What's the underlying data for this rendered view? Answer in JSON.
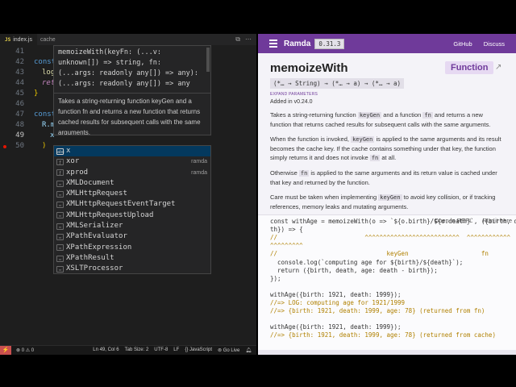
{
  "editor": {
    "tabs": [
      {
        "icon": "JS",
        "label": "index.js"
      },
      {
        "label": "cache"
      }
    ],
    "lines": [
      {
        "num": "41",
        "y": 0
      },
      {
        "num": "42",
        "y": 1
      },
      {
        "num": "43",
        "y": 2
      },
      {
        "num": "44",
        "y": 3
      },
      {
        "num": "45",
        "y": 4
      },
      {
        "num": "46",
        "y": 5
      },
      {
        "num": "47",
        "y": 6
      },
      {
        "num": "48",
        "y": 7
      },
      {
        "num": "49",
        "y": 8
      },
      {
        "num": "50",
        "y": 9
      }
    ],
    "code": {
      "l42": "const",
      "l43": "log",
      "l44": "ret",
      "l45": "}",
      "l47": "const",
      "l48": "R.m",
      "l49": "x",
      "l50": ")"
    },
    "hover": {
      "sig1": "memoizeWith(keyFn: (...v:",
      "sig2": "unknown[]) => string, fn:",
      "sig3": "(...args: readonly any[]) => any):",
      "sig4": "(...args: readonly any[]) => any",
      "doc": "Takes a string-returning function  keyGen  and a function  fn  and returns a new function that returns cached results for subsequent calls with the same arguments."
    },
    "suggestions": [
      {
        "label": "x",
        "detail": "",
        "kind": "abc"
      },
      {
        "label": "xor",
        "detail": "ramda",
        "kind": "fn"
      },
      {
        "label": "xprod",
        "detail": "ramda",
        "kind": "fn"
      },
      {
        "label": "XMLDocument",
        "detail": "",
        "kind": "var"
      },
      {
        "label": "XMLHttpRequest",
        "detail": "",
        "kind": "var"
      },
      {
        "label": "XMLHttpRequestEventTarget",
        "detail": "",
        "kind": "var"
      },
      {
        "label": "XMLHttpRequestUpload",
        "detail": "",
        "kind": "var"
      },
      {
        "label": "XMLSerializer",
        "detail": "",
        "kind": "var"
      },
      {
        "label": "XPathEvaluator",
        "detail": "",
        "kind": "var"
      },
      {
        "label": "XPathExpression",
        "detail": "",
        "kind": "var"
      },
      {
        "label": "XPathResult",
        "detail": "",
        "kind": "var"
      },
      {
        "label": "XSLTProcessor",
        "detail": "",
        "kind": "var"
      }
    ],
    "status": {
      "problems": "⊗ 0 ⚠ 0",
      "position": "Ln 49, Col 6",
      "tabsize": "Tab Size: 2",
      "encoding": "UTF-8",
      "eol": "LF",
      "language": "{} JavaScript",
      "golive": "⊚ Go Live"
    }
  },
  "docs": {
    "brand": "Ramda",
    "version": "0.31.3",
    "nav": [
      "GitHub",
      "Discuss"
    ],
    "title": "memoizeWith",
    "badge": "Function",
    "signature": "(*… → String) → (*… → a) → (*… → a)",
    "expand": "EXPAND PARAMETERS",
    "added": "Added in v0.24.0",
    "p1_a": "Takes a string-returning function ",
    "p1_b": "keyGen",
    "p1_c": " and a function ",
    "p1_d": "fn",
    "p1_e": " and returns a new function that returns cached results for subsequent calls with the same arguments.",
    "p2_a": "When the function is invoked, ",
    "p2_b": "keyGen",
    "p2_c": " is applied to the same arguments and its result becomes the cache key. If the cache contains something under that key, the function simply returns it and does not invoke ",
    "p2_d": "fn",
    "p2_e": " at all.",
    "p3_a": "Otherwise ",
    "p3_b": "fn",
    "p3_c": " is applied to the same arguments and its return value is cached under that key and returned by the function.",
    "p4_a": "Care must be taken when implementing ",
    "p4_b": "keyGen",
    "p4_c": " to avoid key collision, or if tracking references, memory leaks and mutating arguments.",
    "example_links": [
      "Open in REPL",
      "Run it here"
    ],
    "example": {
      "e1": "const withAge = memoizeWith(o => `${o.birth}/${o.death}`, ({birth, dea",
      "e2": "th}) => {",
      "e3": "//                        ^^^^^^^^^^^^^^^^^^^^^^^^^^  ^^^^^^^^^^^^",
      "e4": "^^^^^^^^^",
      "e5": "//                              keyGen                    fn",
      "e6": "  console.log(`computing age for ${birth}/${death}`);",
      "e7": "  return ({birth, death, age: death - birth});",
      "e8": "});",
      "e9": "withAge({birth: 1921, death: 1999});",
      "e10": "//=> LOG: computing age for 1921/1999",
      "e11": "//=> {birth: 1921, death: 1999, age: 78} (returned from fn)",
      "e12": "withAge({birth: 1921, death: 1999});",
      "e13": "//=> {birth: 1921, death: 1999, age: 78} (returned from cache)"
    }
  }
}
